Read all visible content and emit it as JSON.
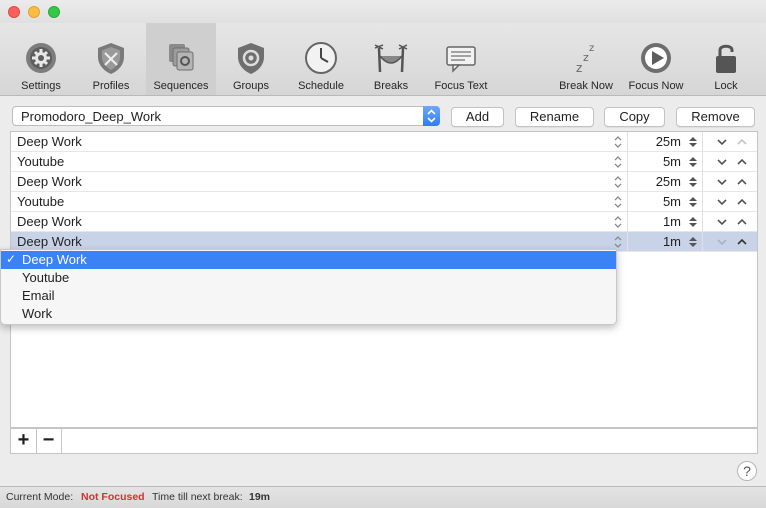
{
  "toolbar": {
    "items": [
      {
        "label": "Settings",
        "icon": "settings-gear-icon"
      },
      {
        "label": "Profiles",
        "icon": "profiles-shield-icon"
      },
      {
        "label": "Sequences",
        "icon": "sequences-stack-icon",
        "selected": true
      },
      {
        "label": "Groups",
        "icon": "groups-shield-icon"
      },
      {
        "label": "Schedule",
        "icon": "clock-icon"
      },
      {
        "label": "Breaks",
        "icon": "hammock-icon"
      },
      {
        "label": "Focus Text",
        "icon": "focus-text-icon"
      },
      {
        "label": "Break Now",
        "icon": "zzz-icon"
      },
      {
        "label": "Focus Now",
        "icon": "play-icon"
      },
      {
        "label": "Lock",
        "icon": "lock-icon"
      }
    ]
  },
  "sequence": {
    "selected": "Promodoro_Deep_Work",
    "buttons": {
      "add": "Add",
      "rename": "Rename",
      "copy": "Copy",
      "remove": "Remove"
    }
  },
  "rows": [
    {
      "name": "Deep Work",
      "duration": "25m"
    },
    {
      "name": "Youtube",
      "duration": "5m"
    },
    {
      "name": "Deep Work",
      "duration": "25m"
    },
    {
      "name": "Youtube",
      "duration": "5m"
    },
    {
      "name": "Deep Work",
      "duration": "1m"
    },
    {
      "name": "Deep Work",
      "duration": "1m",
      "selected": true
    }
  ],
  "dropdown": {
    "options": [
      "Deep Work",
      "Youtube",
      "Email",
      "Work"
    ],
    "selected": "Deep Work",
    "check": "✓"
  },
  "bottom": {
    "add": "+",
    "remove": "−",
    "help": "?"
  },
  "status": {
    "mode_label": "Current Mode:",
    "mode_value": "Not Focused",
    "break_label": "Time till next break:",
    "break_value": "19m"
  },
  "colors": {
    "accent": "#3b82f6",
    "status_red": "#d0342c",
    "selected_row": "#c9d3e8"
  }
}
